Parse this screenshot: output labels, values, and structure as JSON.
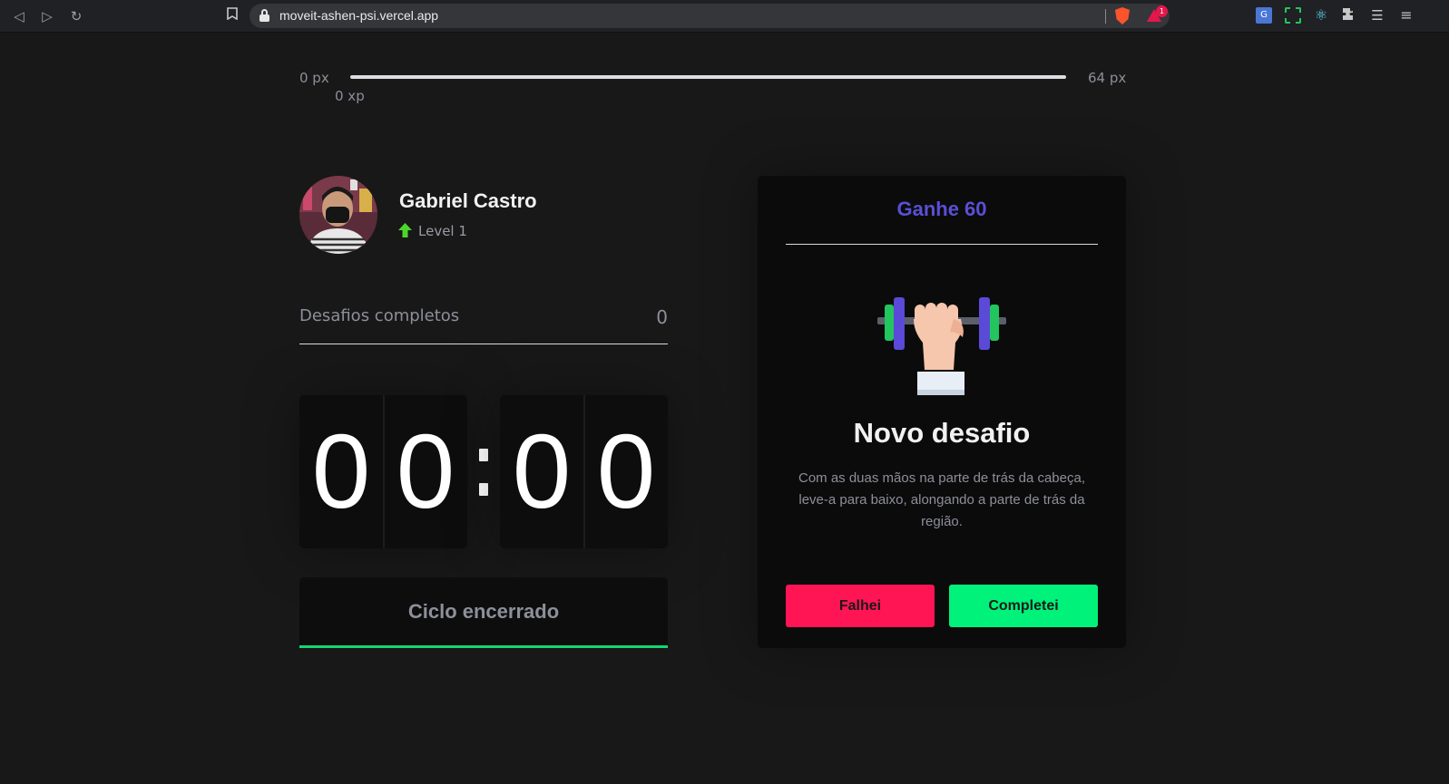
{
  "browser": {
    "url": "moveit-ashen-psi.vercel.app",
    "back_icon": "◁",
    "forward_icon": "▷",
    "reload_icon": "↻",
    "bookmark_icon": "🔖",
    "rewards_badge": "1",
    "translate_icon": "G",
    "react_icon": "⚛",
    "puzzle_icon": "✦",
    "playlist_icon": "☰",
    "menu_icon": "≡"
  },
  "xp_bar": {
    "min_label": "0 px",
    "max_label": "64 px",
    "current_label": "0 xp",
    "progress_percent": 0
  },
  "profile": {
    "name": "Gabriel Castro",
    "level": "Level 1"
  },
  "completed_challenges": {
    "label": "Desafios completos",
    "value": "0"
  },
  "countdown": {
    "minute_left": "0",
    "minute_right": "0",
    "second_left": "0",
    "second_right": "0"
  },
  "cycle_button": {
    "label": "Ciclo encerrado"
  },
  "challenge": {
    "header": "Ganhe 60",
    "title": "Novo desafio",
    "description": "Com as duas mãos na parte de trás da cabeça, leve-a para baixo, alongando a parte de trás da região.",
    "fail_label": "Falhei",
    "complete_label": "Completei"
  },
  "colors": {
    "background": "#181818",
    "card": "#0b0b0b",
    "accent_purple": "#5a4fd6",
    "fail_red": "#ff1454",
    "success_green": "#00f27a"
  }
}
